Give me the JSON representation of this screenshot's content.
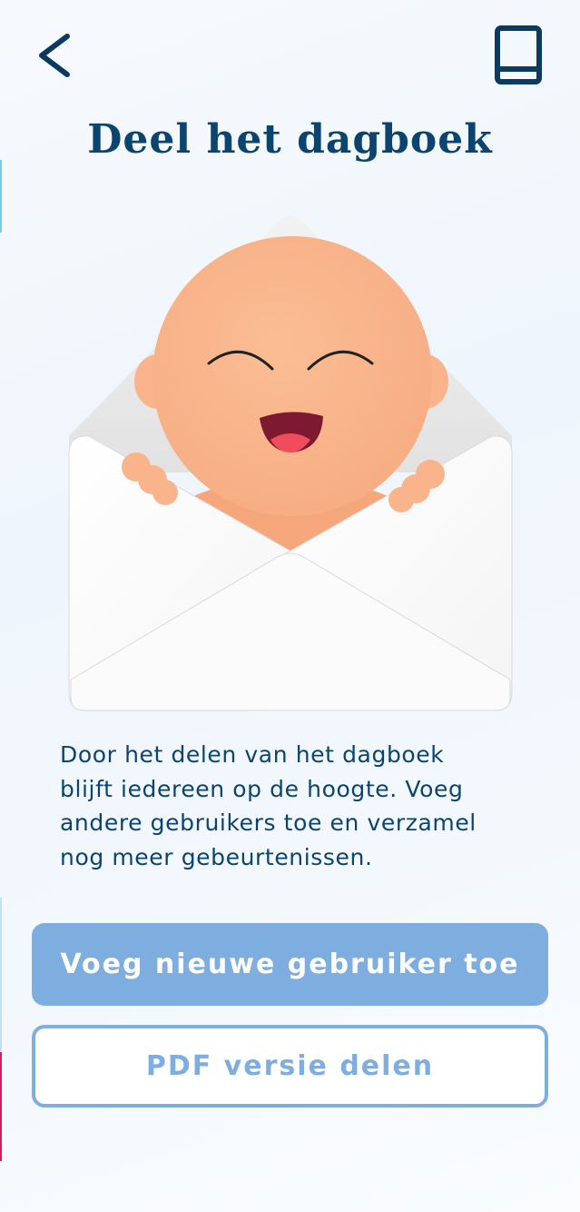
{
  "header": {
    "back_icon": "chevron-left-icon",
    "diary_icon": "book-icon",
    "title": "Deel het dagboek"
  },
  "illustration": {
    "subject": "baby-in-envelope"
  },
  "description": {
    "lines": [
      "Door het delen van het dagboek",
      "blijft iedereen op de hoogte. Voeg",
      "andere gebruikers toe en verzamel",
      "nog meer gebeurtenissen."
    ]
  },
  "actions": {
    "add_user_label": "Voeg nieuwe gebruiker toe",
    "share_pdf_label": "PDF versie delen"
  },
  "colors": {
    "primary_text": "#0c4470",
    "accent": "#7eaedf",
    "skin": "#f9b48b",
    "mouth": "#7d1930",
    "tongue": "#ef4d5c"
  }
}
